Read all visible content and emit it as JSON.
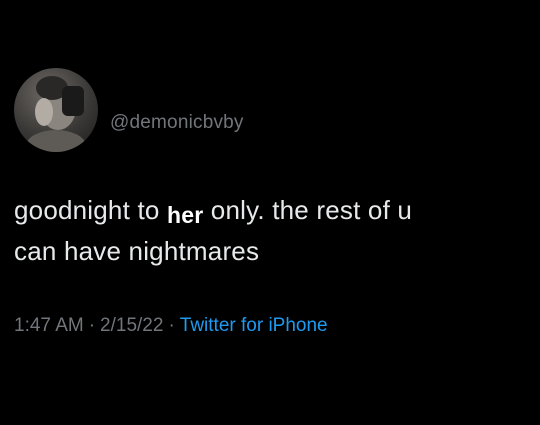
{
  "user": {
    "handle": "@demonicbvby"
  },
  "tweet": {
    "line1_before": "goodnight to ",
    "line1_emphasis": "her",
    "line1_after": " only. the rest of u",
    "line2": "can have nightmares"
  },
  "meta": {
    "time": "1:47 AM",
    "separator": "·",
    "date": "2/15/22",
    "source": "Twitter for iPhone"
  },
  "colors": {
    "background": "#000000",
    "text": "#e7e9ea",
    "muted": "#71767b",
    "link": "#1d9bf0"
  }
}
